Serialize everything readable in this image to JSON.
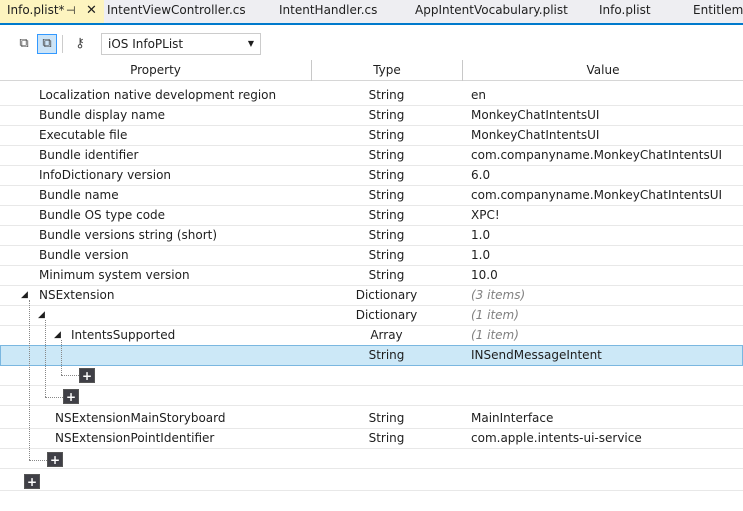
{
  "tabs": [
    {
      "label": "Info.plist*"
    },
    {
      "label": "IntentViewController.cs"
    },
    {
      "label": "IntentHandler.cs"
    },
    {
      "label": "AppIntentVocabulary.plist"
    },
    {
      "label": "Info.plist"
    },
    {
      "label": "Entitleme"
    }
  ],
  "toolbar": {
    "combo_value": "iOS InfoPList"
  },
  "columns": {
    "property": "Property",
    "type": "Type",
    "value": "Value"
  },
  "rows": [
    {
      "property": "Localization native development region",
      "type": "String",
      "value": "en"
    },
    {
      "property": "Bundle display name",
      "type": "String",
      "value": "MonkeyChatIntentsUI"
    },
    {
      "property": "Executable file",
      "type": "String",
      "value": "MonkeyChatIntentsUI"
    },
    {
      "property": "Bundle identifier",
      "type": "String",
      "value": "com.companyname.MonkeyChatIntentsUI"
    },
    {
      "property": "InfoDictionary version",
      "type": "String",
      "value": "6.0"
    },
    {
      "property": "Bundle name",
      "type": "String",
      "value": "com.companyname.MonkeyChatIntentsUI"
    },
    {
      "property": "Bundle OS type code",
      "type": "String",
      "value": "XPC!"
    },
    {
      "property": "Bundle versions string (short)",
      "type": "String",
      "value": "1.0"
    },
    {
      "property": "Bundle version",
      "type": "String",
      "value": "1.0"
    },
    {
      "property": "Minimum system version",
      "type": "String",
      "value": "10.0"
    },
    {
      "property": "NSExtension",
      "type": "Dictionary",
      "value": "(3 items)"
    },
    {
      "property": "",
      "type": "Dictionary",
      "value": "(1 item)"
    },
    {
      "property": "IntentsSupported",
      "type": "Array",
      "value": "(1 item)"
    },
    {
      "property": "",
      "type": "String",
      "value": "INSendMessageIntent"
    },
    {
      "property": "NSExtensionMainStoryboard",
      "type": "String",
      "value": "MainInterface"
    },
    {
      "property": "NSExtensionPointIdentifier",
      "type": "String",
      "value": "com.apple.intents-ui-service"
    }
  ],
  "colors": {
    "active_tab": "#fdf4bf",
    "accent": "#007acc",
    "selected_row": "#cce8f7"
  }
}
